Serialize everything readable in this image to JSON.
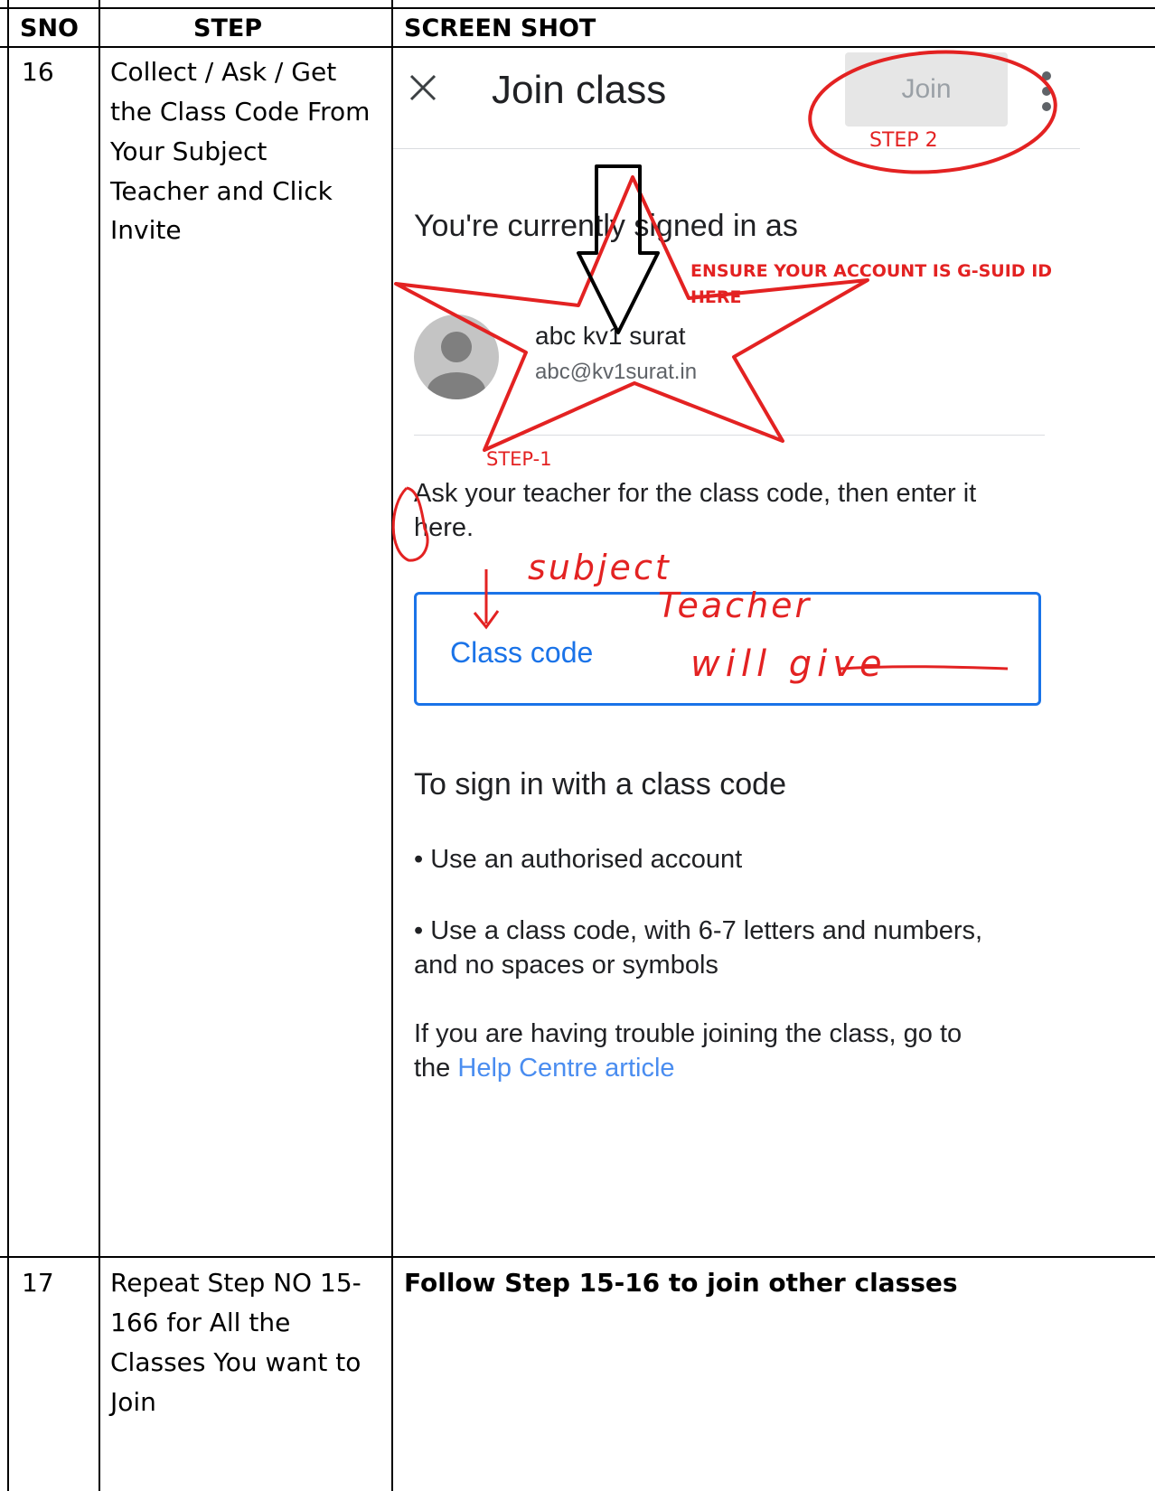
{
  "table": {
    "headers": {
      "sno": "SNO",
      "step": "STEP",
      "screenshot": "SCREEN SHOT"
    },
    "rows": [
      {
        "sno": "16",
        "step_lines": [
          "Collect / Ask / Get",
          "the Class Code From",
          "Your Subject",
          "Teacher and Click",
          "Invite"
        ]
      },
      {
        "sno": "17",
        "step_lines": [
          "Repeat Step NO 15-",
          "166 for All the",
          "Classes You want to",
          "Join"
        ],
        "screenshot_text": "Follow Step 15-16 to join other classes"
      }
    ]
  },
  "screen": {
    "title": "Join class",
    "join_button": "Join",
    "signed_in_heading": "You're currently signed in as",
    "account_name": "abc kv1 surat",
    "account_email": "abc@kv1surat.in",
    "instruction": [
      "Ask your teacher for the class code, then enter it",
      "here."
    ],
    "class_code_label": "Class code",
    "sign_in_heading": "To sign in with a class code",
    "bullet1": "• Use an authorised account",
    "bullet2": [
      "• Use a class code, with 6-7 letters and numbers,",
      "and no spaces or symbols"
    ],
    "trouble": [
      "If you are having trouble joining the class, go to",
      "the "
    ],
    "help_link": "Help Centre article"
  },
  "annotations": {
    "step2": "STEP 2",
    "step1": "STEP-1",
    "ensure": [
      "ENSURE YOUR ACCOUNT IS G-SUID ID",
      "HERE"
    ],
    "handwriting": [
      "subject",
      "Teacher",
      "will give"
    ]
  },
  "colors": {
    "annotation_red": "#e32222",
    "accent_blue": "#1a73e8",
    "link_blue": "#4a8df0",
    "join_bg": "#e6e6e6"
  }
}
